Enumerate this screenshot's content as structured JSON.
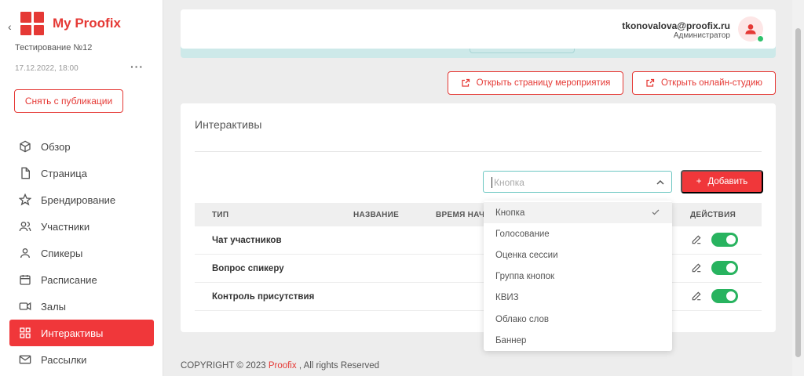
{
  "sidebar": {
    "brand": "My Proofix",
    "event_name": "Тестирование №12",
    "event_date": "17.12.2022, 18:00",
    "more": "···",
    "unpublish_label": "Снять с публикации",
    "items": [
      {
        "label": "Обзор",
        "icon": "cube-icon"
      },
      {
        "label": "Страница",
        "icon": "file-icon"
      },
      {
        "label": "Брендирование",
        "icon": "star-icon"
      },
      {
        "label": "Участники",
        "icon": "users-icon"
      },
      {
        "label": "Спикеры",
        "icon": "user-icon"
      },
      {
        "label": "Расписание",
        "icon": "calendar-icon"
      },
      {
        "label": "Залы",
        "icon": "video-icon"
      },
      {
        "label": "Интерактивы",
        "icon": "grid-icon",
        "active": true
      },
      {
        "label": "Рассылки",
        "icon": "mail-icon"
      }
    ]
  },
  "header": {
    "email": "tkonovalova@proofix.ru",
    "role": "Администратор"
  },
  "actions": {
    "open_page": "Открыть страницу мероприятия",
    "open_studio": "Открыть онлайн-студию"
  },
  "card": {
    "title": "Интерактивы",
    "select_placeholder": "Кнопка",
    "add_label": "Добавить",
    "columns": [
      "ТИП",
      "НАЗВАНИЕ",
      "ВРЕМЯ НАЧ",
      "ДЕЙСТВИЯ"
    ],
    "rows": [
      {
        "type": "Чат участников",
        "enabled": true
      },
      {
        "type": "Вопрос спикеру",
        "enabled": true
      },
      {
        "type": "Контроль присутствия",
        "enabled": true
      }
    ]
  },
  "dropdown": {
    "options": [
      "Кнопка",
      "Голосование",
      "Оценка сессии",
      "Группа кнопок",
      "КВИЗ",
      "Облако слов",
      "Баннер"
    ],
    "selected": "Кнопка"
  },
  "footer": {
    "prefix": "COPYRIGHT © 2023",
    "brand": "Proofix",
    "suffix": ", All rights Reserved"
  },
  "colors": {
    "accent": "#f0373a",
    "toggle_on": "#28b35f",
    "info_strip": "#cde9e9"
  }
}
